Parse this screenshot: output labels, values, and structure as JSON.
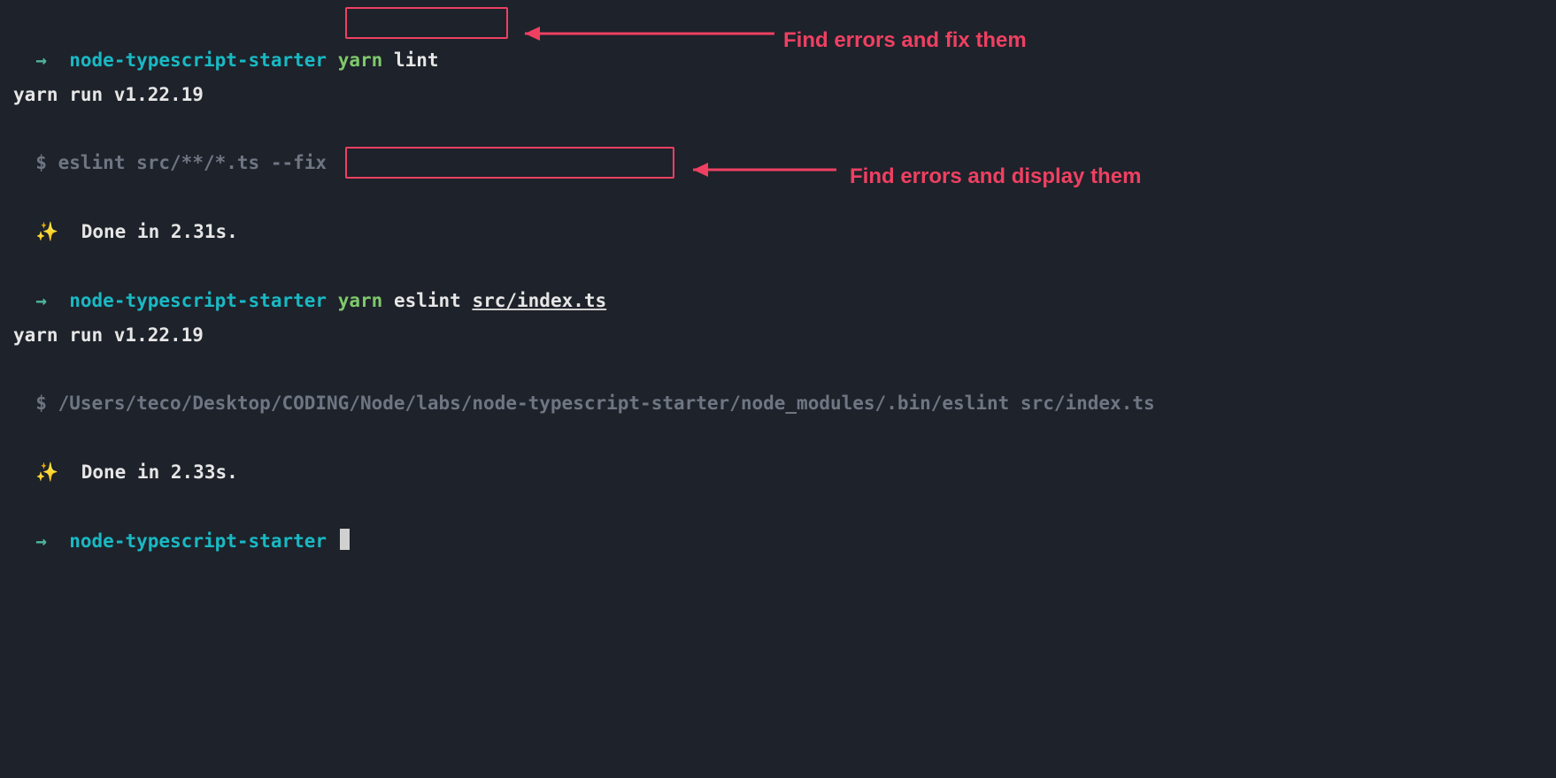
{
  "colors": {
    "bg": "#1e222a",
    "teal": "#19b9c4",
    "green": "#7fc96b",
    "arrow_teal": "#4db6a0",
    "dim": "#6f7683",
    "white": "#e6e6e6",
    "gold": "#f4c542",
    "annot_red": "#ef4062"
  },
  "prompt": {
    "arrow": "→",
    "dir": "node-typescript-starter"
  },
  "run1": {
    "cmd_word": "yarn",
    "cmd_rest": "lint",
    "yarn_line": "yarn run v1.22.19",
    "exec_prefix": "$",
    "exec_cmd": "eslint src/**/*.ts --fix",
    "sparkle": "✨",
    "done": "Done in 2.31s."
  },
  "run2": {
    "cmd_word": "yarn",
    "cmd_rest_a": "eslint ",
    "cmd_rest_b": "src/index.ts",
    "yarn_line": "yarn run v1.22.19",
    "exec_prefix": "$",
    "exec_cmd": "/Users/teco/Desktop/CODING/Node/labs/node-typescript-starter/node_modules/.bin/eslint src/index.ts",
    "sparkle": "✨",
    "done": "Done in 2.33s."
  },
  "annotations": {
    "a1": "Find errors and fix them",
    "a2": "Find errors and display them"
  }
}
